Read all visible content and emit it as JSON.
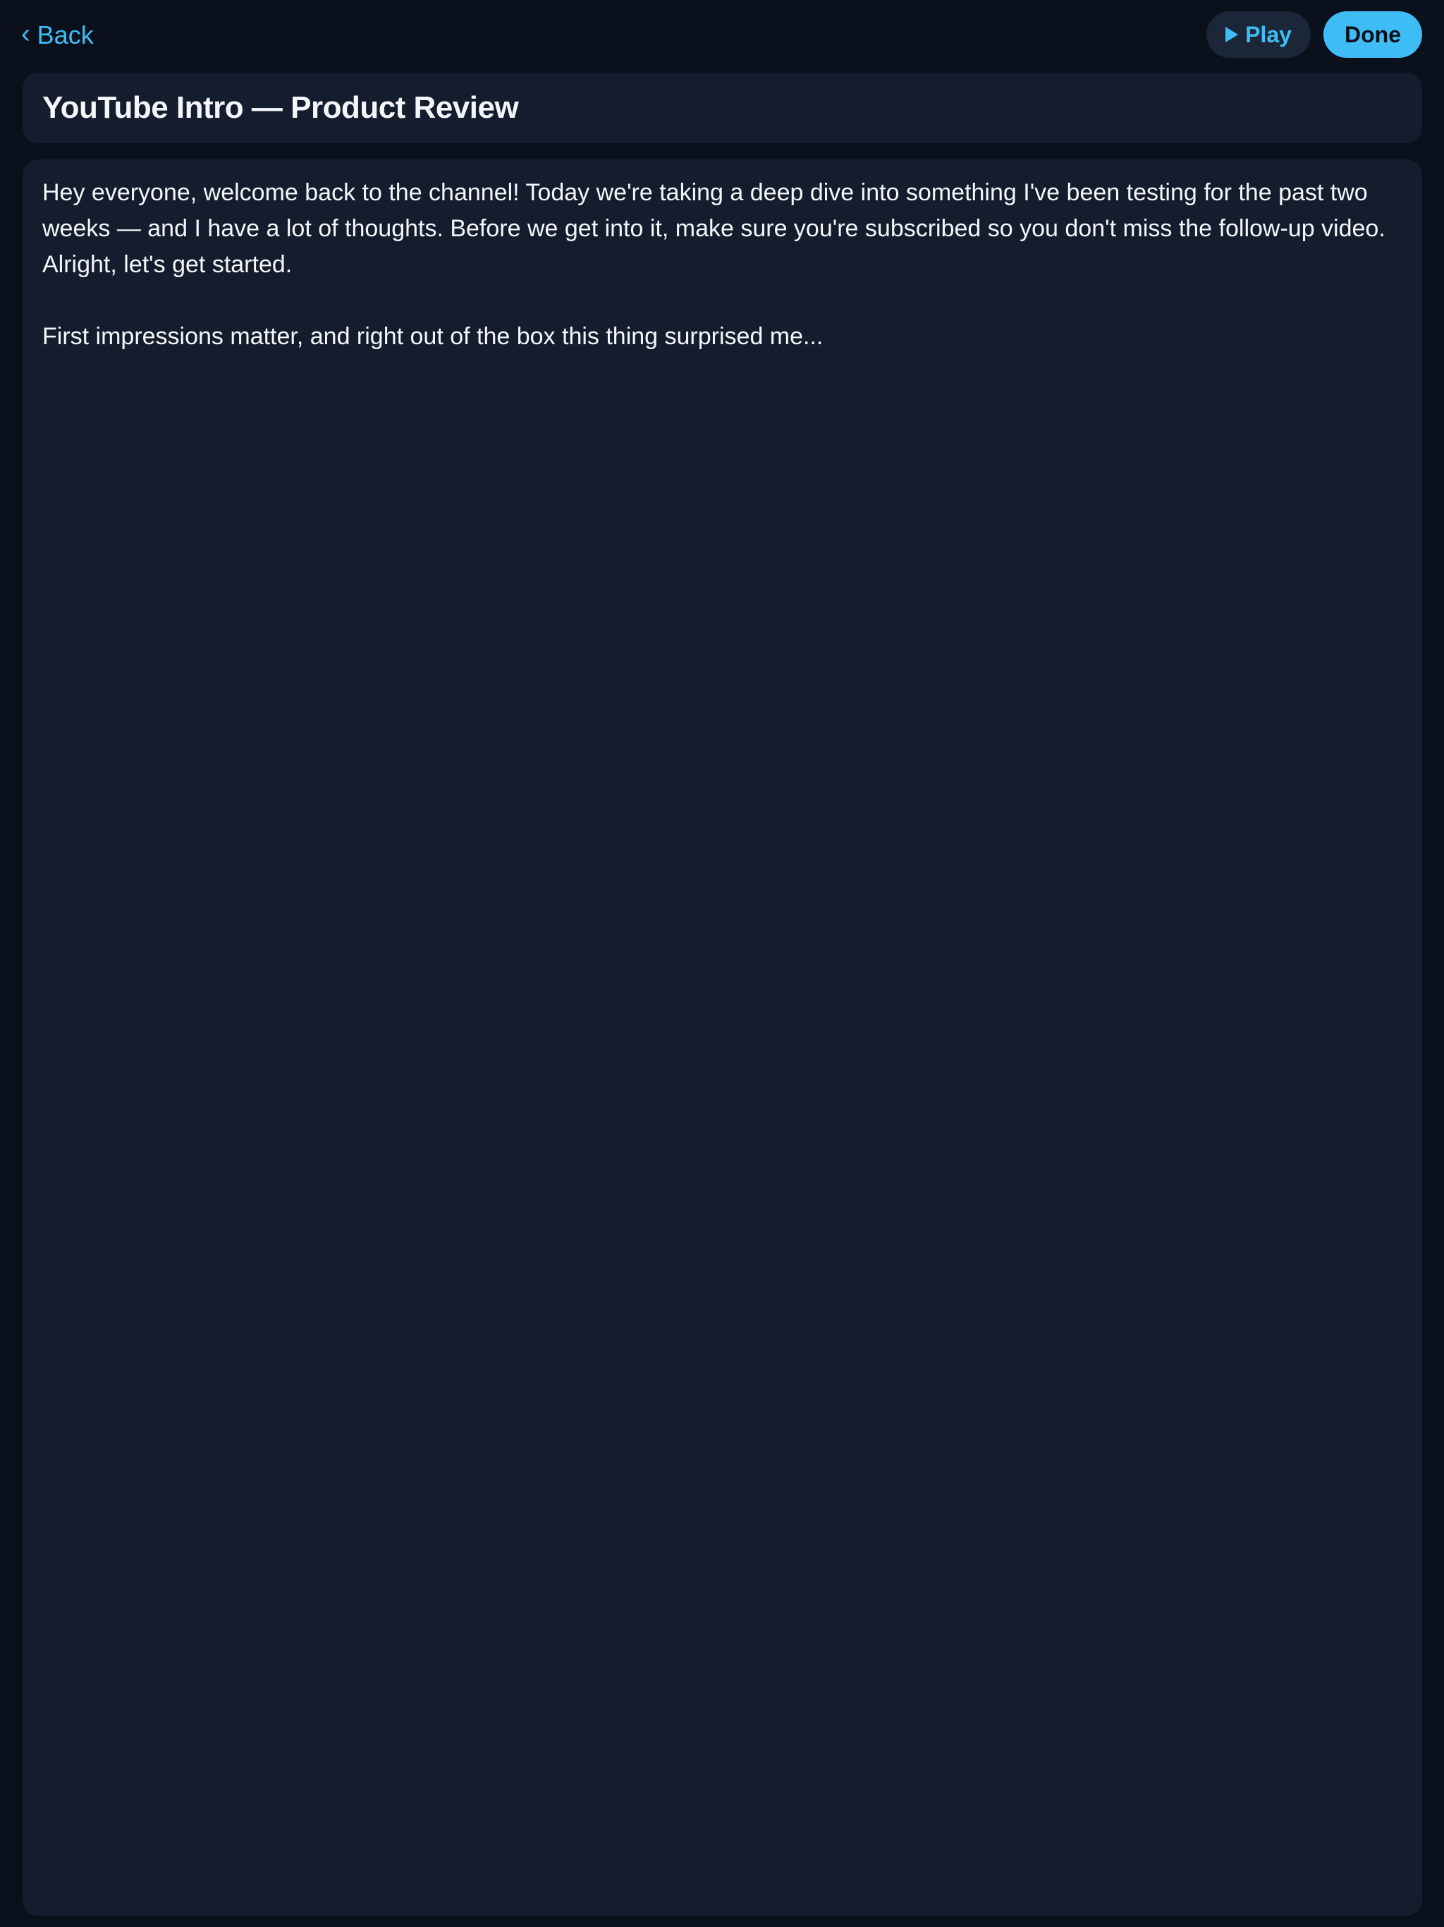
{
  "nav": {
    "back_label": "Back",
    "play_label": "Play",
    "done_label": "Done"
  },
  "document": {
    "title": "YouTube Intro — Product Review",
    "paragraphs": [
      "Hey everyone, welcome back to the channel! Today we're taking a deep dive into something I've been testing for the past two weeks — and I have a lot of thoughts. Before we get into it, make sure you're subscribed so you don't miss the follow-up video. Alright, let's get started.",
      "First impressions matter, and right out of the box this thing surprised me..."
    ]
  },
  "icons": {
    "back": "chevron-left-icon",
    "play": "play-icon"
  },
  "colors": {
    "background": "#0a111d",
    "card": "#141d2e",
    "accent": "#3ebdf5",
    "play_button_bg": "#1b2638",
    "text": "#f4f6fa"
  }
}
